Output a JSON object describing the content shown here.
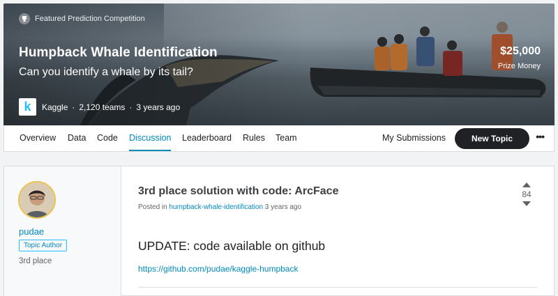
{
  "banner": {
    "featured_label": "Featured Prediction Competition",
    "title": "Humpback Whale Identification",
    "subtitle": "Can you identify a whale by its tail?",
    "host": "Kaggle",
    "teams": "2,120 teams",
    "age": "3 years ago",
    "prize_amount": "$25,000",
    "prize_label": "Prize Money"
  },
  "tabs": {
    "items": [
      "Overview",
      "Data",
      "Code",
      "Discussion",
      "Leaderboard",
      "Rules",
      "Team"
    ],
    "active": "Discussion",
    "my_submissions": "My Submissions",
    "new_topic": "New Topic"
  },
  "post": {
    "author": "pudae",
    "author_badge": "Topic Author",
    "author_rank": "3rd place",
    "title": "3rd place solution with code: ArcFace",
    "posted_prefix": "Posted in",
    "posted_in": "humpback-whale-identification",
    "posted_age": "3 years ago",
    "votes": "84",
    "heading": "UPDATE: code available on github",
    "link": "https://github.com/pudae/kaggle-humpback"
  },
  "colors": {
    "accent": "#008abc",
    "dark_button": "#202124"
  }
}
